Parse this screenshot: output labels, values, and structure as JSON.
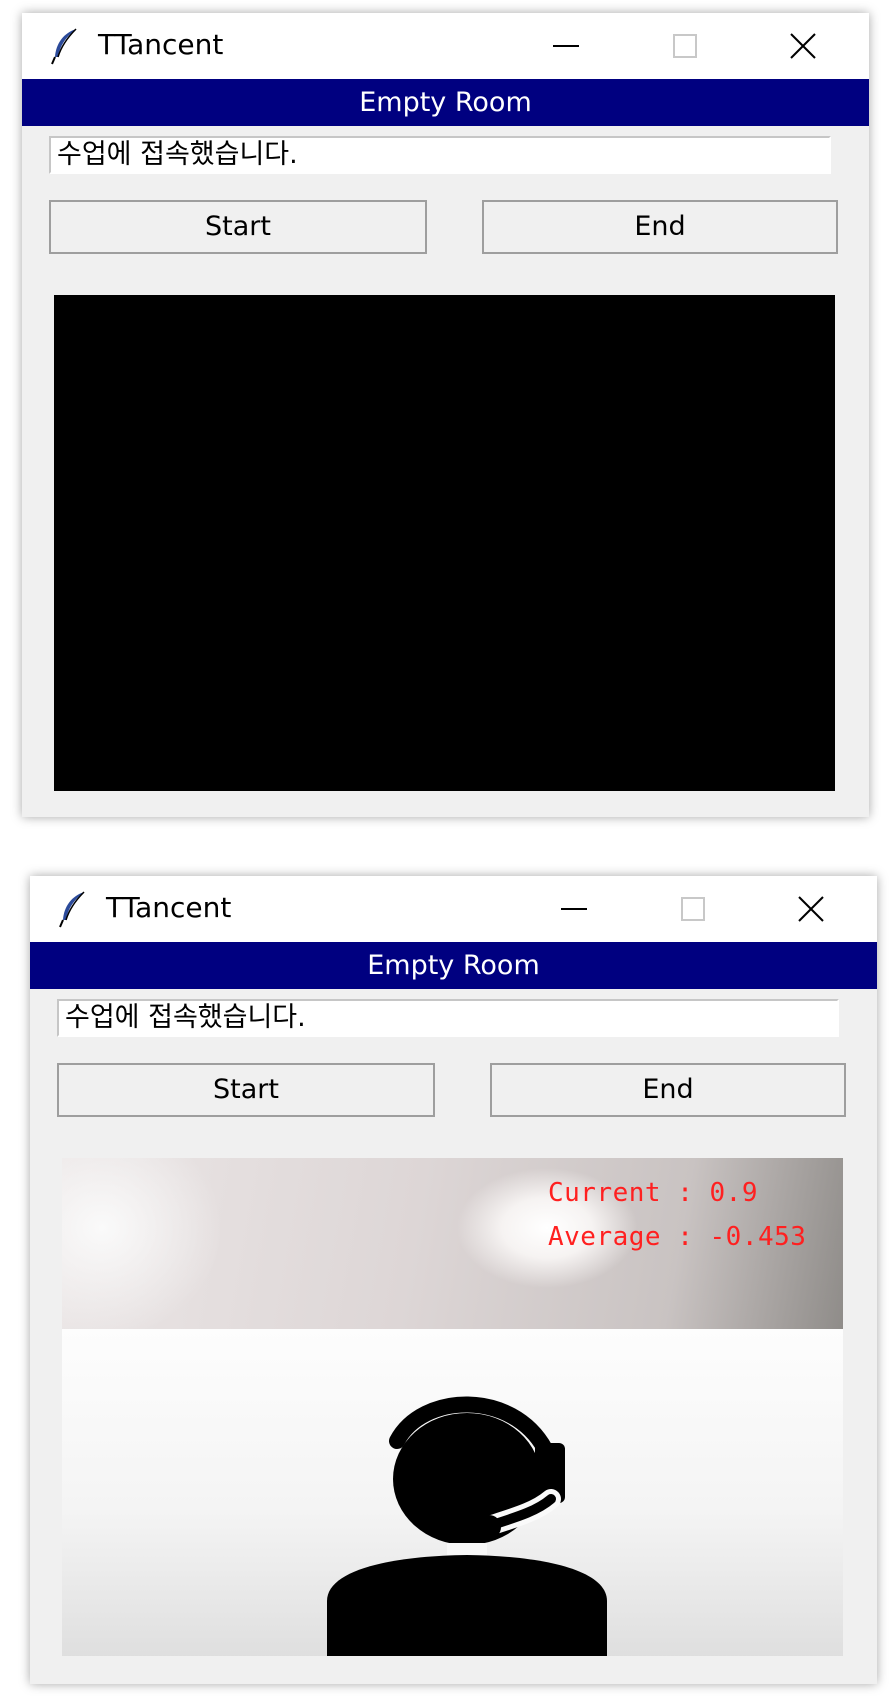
{
  "windows": [
    {
      "title": "TTancent",
      "room_header": "Empty Room",
      "status_text": "수업에 접속했습니다.",
      "buttons": {
        "start": "Start",
        "end": "End"
      },
      "video": {
        "state": "black"
      }
    },
    {
      "title": "TTancent",
      "room_header": "Empty Room",
      "status_text": "수업에 접속했습니다.",
      "buttons": {
        "start": "Start",
        "end": "End"
      },
      "video": {
        "state": "camera-feed",
        "current_text": "Current : 0.9",
        "average_text": "Average : -0.453",
        "overlay_color": "#ff2020",
        "placeholder_icon": "headset-person-icon"
      }
    }
  ],
  "colors": {
    "header_bg": "#000080",
    "header_text": "#ffffff",
    "window_bg": "#f0f0f0"
  },
  "icons": {
    "app_icon": "feather-icon",
    "minimize": "minimize-icon",
    "maximize": "maximize-icon",
    "close": "close-icon"
  }
}
